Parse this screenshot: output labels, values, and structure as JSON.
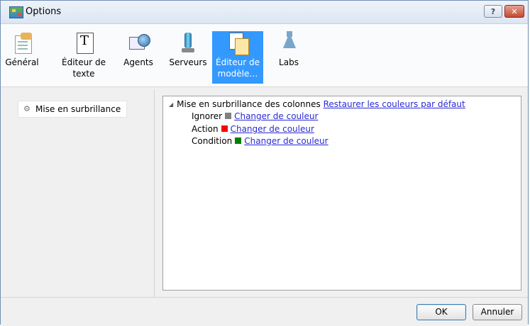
{
  "window": {
    "title": "Options",
    "help_label": "?",
    "close_label": "✕"
  },
  "toolbar": {
    "items": [
      {
        "label": "Général",
        "icon": "general-settings-icon"
      },
      {
        "label": "Éditeur de texte",
        "icon": "text-editor-icon"
      },
      {
        "label": "Agents",
        "icon": "agents-icon"
      },
      {
        "label": "Serveurs",
        "icon": "servers-icon"
      },
      {
        "label": "Éditeur de modèle…",
        "icon": "template-editor-icon",
        "selected": true
      },
      {
        "label": "Labs",
        "icon": "labs-flask-icon"
      }
    ]
  },
  "sidebar": {
    "items": [
      {
        "label": "Mise en surbrillance",
        "icon": "gear-icon"
      }
    ]
  },
  "content": {
    "tree": {
      "label": "Mise en surbrillance des colonnes",
      "reset_link": "Restaurer les couleurs par défaut",
      "children": [
        {
          "label": "Ignorer",
          "color": "#808080",
          "link": "Changer de couleur"
        },
        {
          "label": "Action",
          "color": "#ff0000",
          "link": "Changer de couleur"
        },
        {
          "label": "Condition",
          "color": "#008000",
          "link": "Changer de couleur"
        }
      ]
    }
  },
  "footer": {
    "ok_label": "OK",
    "cancel_label": "Annuler"
  },
  "colors": {
    "selection": "#3399ff",
    "link": "#2a2ad6"
  }
}
